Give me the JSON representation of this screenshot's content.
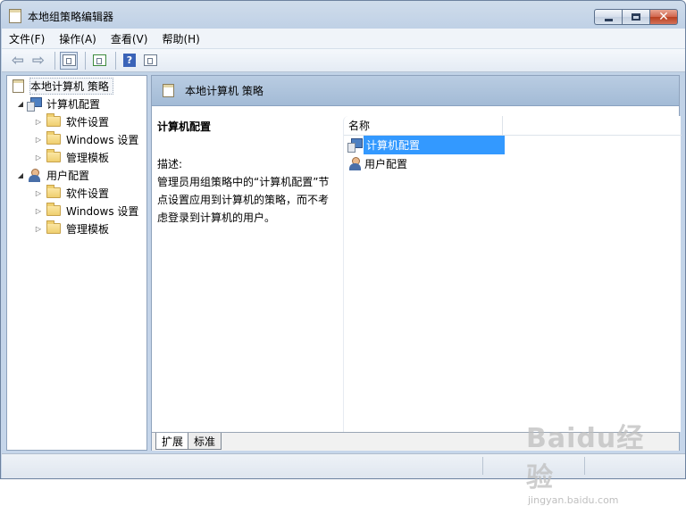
{
  "window": {
    "title": "本地组策略编辑器"
  },
  "menu": [
    {
      "label": "文件(F)"
    },
    {
      "label": "操作(A)"
    },
    {
      "label": "查看(V)"
    },
    {
      "label": "帮助(H)"
    }
  ],
  "toolbar": {
    "icons": [
      "back-arrow-icon",
      "forward-arrow-icon",
      "show-hide-tree-icon",
      "export-list-icon",
      "help-icon",
      "action-pane-icon"
    ],
    "help_glyph": "?"
  },
  "tree": {
    "root": "本地计算机 策略",
    "computer": "计算机配置",
    "user": "用户配置",
    "children": [
      "软件设置",
      "Windows 设置",
      "管理模板"
    ]
  },
  "right": {
    "header": "本地计算机 策略",
    "desc_heading": "计算机配置",
    "desc_label": "描述:",
    "desc_text": "管理员用组策略中的“计算机配置”节点设置应用到计算机的策略，而不考虑登录到计算机的用户。",
    "column_name": "名称",
    "items": [
      "计算机配置",
      "用户配置"
    ]
  },
  "tabs": [
    "扩展",
    "标准"
  ],
  "watermark": {
    "main": "Baidu经验",
    "sub": "jingyan.baidu.com"
  },
  "colors": {
    "selection": "#3399ff",
    "header_band": "#a3bbd6",
    "close_button": "#c9583c"
  }
}
